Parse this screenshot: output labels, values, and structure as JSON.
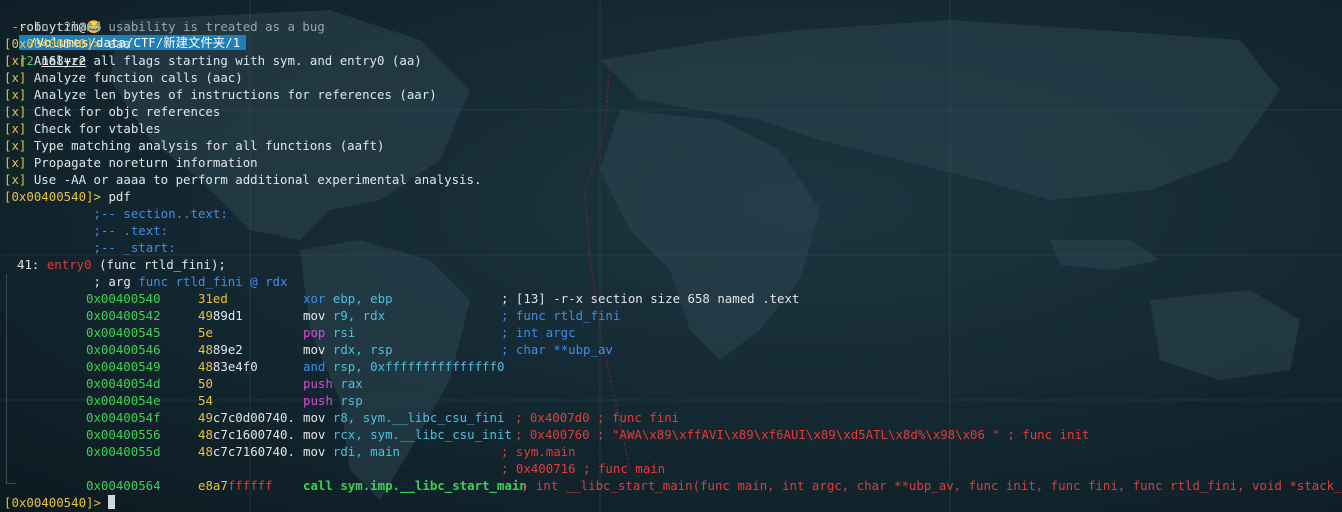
{
  "prompt_bar": {
    "user": "roboytim@",
    "emoji": "😂",
    "path": "/Volumes/data/CTF/新建文件夹/1",
    "cmd": "r2",
    "file": "168+r2"
  },
  "lines": {
    "fortune": " -- In r2land usability is treated as a bug",
    "addr1": "[0x00400540]> ",
    "cmd1": "aaa",
    "x_tag": "[x]",
    "analysis": [
      " Analyze all flags starting with sym. and entry0 (aa)",
      " Analyze function calls (aac)",
      " Analyze len bytes of instructions for references (aar)",
      " Check for objc references",
      " Check for vtables",
      " Type matching analysis for all functions (aaft)",
      " Propagate noreturn information",
      " Use -AA or aaaa to perform additional experimental analysis."
    ],
    "addr2": "[0x00400540]> ",
    "cmd2": "pdf",
    "sections": [
      "            ;-- section..text:",
      "            ;-- .text:",
      "            ;-- _start:"
    ],
    "fn_size": "41: ",
    "fn_name": "entry0",
    "fn_sig": " (func rtld_fini);",
    "arg_prefix": "            ; arg ",
    "arg_detail": "func rtld_fini @ rdx",
    "addr_final": "[0x00400540]> "
  },
  "disasm": [
    {
      "addr": "0x00400540",
      "bytes_hi": "31ed",
      "bytes_lo": "",
      "mnem": "xor",
      "ops": "ebp, ebp",
      "comment": "; [13] -r-x section size 658 named .text",
      "ccls": "w"
    },
    {
      "addr": "0x00400542",
      "bytes_hi": "49",
      "bytes_lo": "89d1",
      "mnem": "mov",
      "ops": "r9, rdx",
      "comment": "; func rtld_fini",
      "ccls": "b"
    },
    {
      "addr": "0x00400545",
      "bytes_hi": "5e",
      "bytes_lo": "",
      "mnem": "pop",
      "ops": "rsi",
      "comment": "; int argc",
      "ccls": "b"
    },
    {
      "addr": "0x00400546",
      "bytes_hi": "48",
      "bytes_lo": "89e2",
      "mnem": "mov",
      "ops": "rdx, rsp",
      "comment": "; char **ubp_av",
      "ccls": "b"
    },
    {
      "addr": "0x00400549",
      "bytes_hi": "48",
      "bytes_lo": "83e4f0",
      "mnem": "and",
      "ops": "rsp, 0xfffffffffffffff0",
      "comment": "",
      "ccls": "b"
    },
    {
      "addr": "0x0040054d",
      "bytes_hi": "50",
      "bytes_lo": "",
      "mnem": "push",
      "ops": "rax",
      "comment": "",
      "ccls": "b"
    },
    {
      "addr": "0x0040054e",
      "bytes_hi": "54",
      "bytes_lo": "",
      "mnem": "push",
      "ops": "rsp",
      "comment": "",
      "ccls": "b"
    },
    {
      "addr": "0x0040054f",
      "bytes_hi": "49",
      "bytes_lo": "c7c0d00740.",
      "mnem": "mov",
      "ops": "r8, sym.__libc_csu_fini",
      "comment": "; 0x4007d0 ; func fini",
      "ccls": "r"
    },
    {
      "addr": "0x00400556",
      "bytes_hi": "48",
      "bytes_lo": "c7c1600740.",
      "mnem": "mov",
      "ops": "rcx, sym.__libc_csu_init",
      "comment": "; 0x400760 ; \"AWA\\x89\\xffAVI\\x89\\xf6AUI\\x89\\xd5ATL\\x8d%\\x98\\x06 \" ; func init",
      "ccls": "r"
    },
    {
      "addr": "0x0040055d",
      "bytes_hi": "48",
      "bytes_lo": "c7c7160740.",
      "mnem": "mov",
      "ops": "rdi, main",
      "comment": "; sym.main",
      "ccls": "r"
    },
    {
      "addr": "",
      "bytes_hi": "",
      "bytes_lo": "",
      "mnem": "",
      "ops": "",
      "comment": "; 0x400716 ; func main",
      "ccls": "r"
    },
    {
      "addr": "0x00400564",
      "bytes_hi": "e8a7",
      "bytes_lo": "ffffff",
      "mnem": "call",
      "ops": "sym.imp.__libc_start_main",
      "comment": "; int __libc_start_main(func main, int argc, char **ubp_av, func init, func fini, func rtld_fini, void *stack_end)",
      "ccls": "r"
    }
  ],
  "colors": {
    "addr_green": "#39d353",
    "bytes_yellow": "#e8c33a",
    "reg_blue": "#3b8eea",
    "comment_red": "#e23b3b",
    "path_bg": "#1f7fb8"
  }
}
